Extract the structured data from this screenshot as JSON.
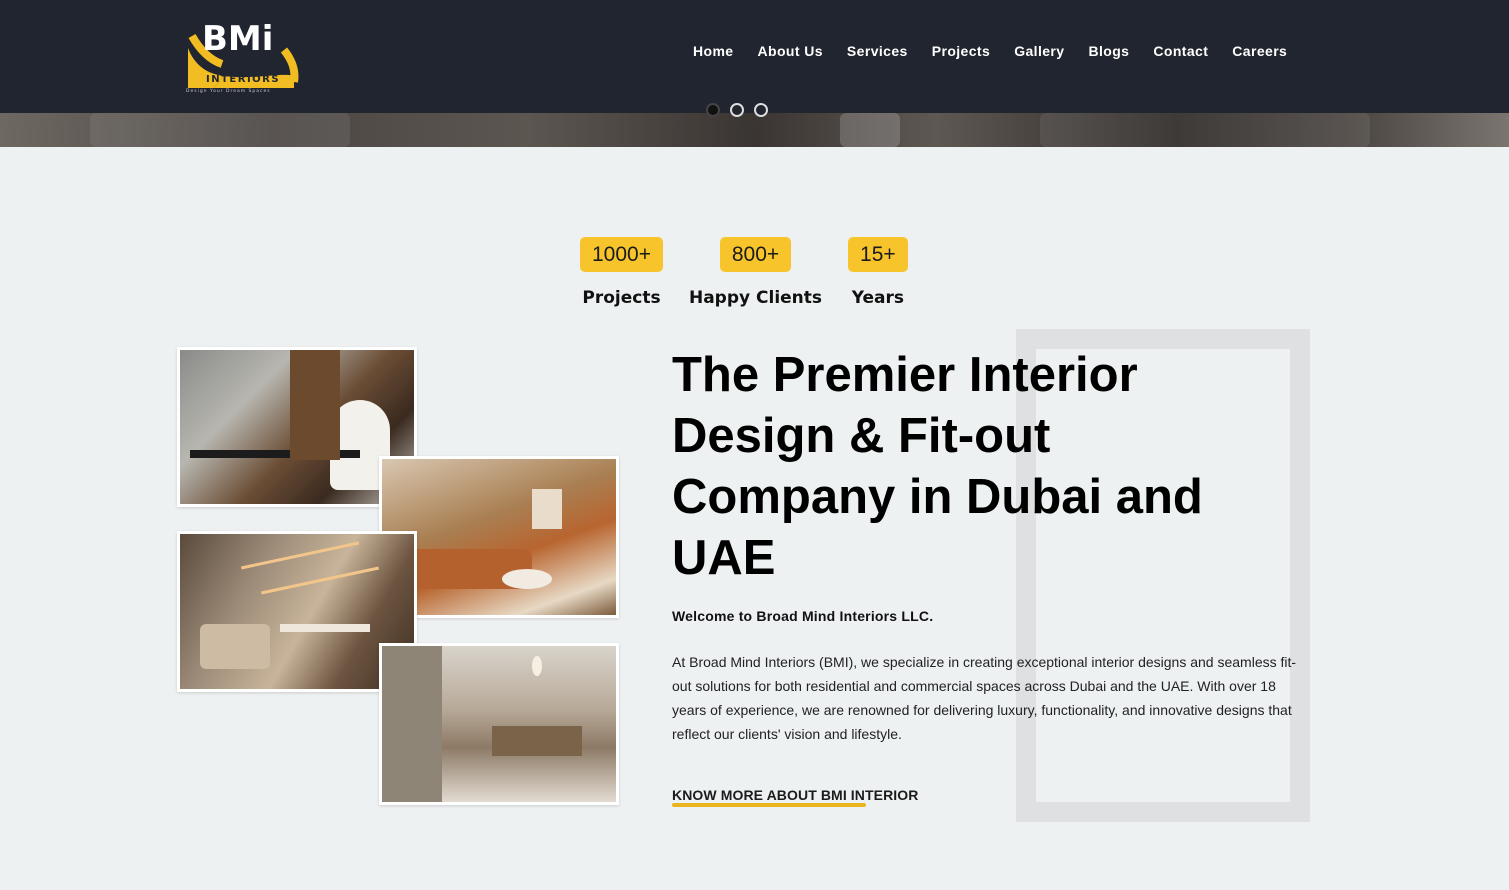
{
  "header": {
    "logo": {
      "wordmark": "BMi",
      "sub": "INTERIORS",
      "tagline": "Design Your Dream Spaces"
    },
    "nav": [
      {
        "label": "Home"
      },
      {
        "label": "About Us"
      },
      {
        "label": "Services"
      },
      {
        "label": "Projects"
      },
      {
        "label": "Gallery"
      },
      {
        "label": "Blogs"
      },
      {
        "label": "Contact"
      },
      {
        "label": "Careers"
      }
    ]
  },
  "slider": {
    "slide_count": 3,
    "active_index": 0
  },
  "stats": [
    {
      "value": "1000+",
      "label": "Projects"
    },
    {
      "value": "800+",
      "label": "Happy Clients"
    },
    {
      "value": "15+",
      "label": "Years"
    }
  ],
  "about": {
    "headline": "The Premier Interior Design & Fit-out Company in Dubai and UAE",
    "welcome": "Welcome to Broad Mind Interiors LLC.",
    "description": "At Broad Mind Interiors (BMI), we specialize in creating exceptional interior designs and seamless fit-out solutions for both residential and commercial spaces across Dubai and the UAE. With over 18 years of experience, we are renowned for delivering luxury, functionality, and innovative designs that reflect our clients' vision and lifestyle.",
    "cta": "KNOW MORE ABOUT BMI INTERIOR"
  },
  "colors": {
    "header_bg": "#20252f",
    "accent": "#f7c52b",
    "page_bg": "#eef1f2"
  }
}
